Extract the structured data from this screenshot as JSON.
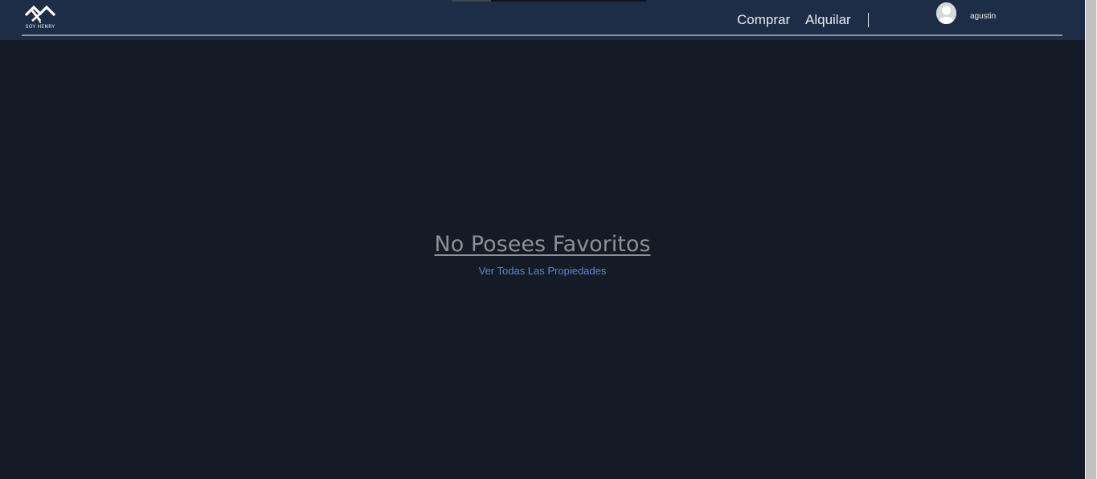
{
  "navbar": {
    "logo_text": "SOY HENRY",
    "links": [
      {
        "label": "Comprar"
      },
      {
        "label": "Alquilar"
      }
    ],
    "user": {
      "name": "agustin"
    }
  },
  "main": {
    "empty_title": "No Posees Favoritos",
    "view_all_link": "Ver Todas Las Propiedades"
  },
  "colors": {
    "page_background": "#141b27",
    "navbar_background": "#1e2d46",
    "link_accent": "#5e86c9",
    "title_gray": "#8c9098"
  },
  "icons": {
    "logo": "house-logo-icon",
    "avatar": "user-avatar-icon"
  }
}
